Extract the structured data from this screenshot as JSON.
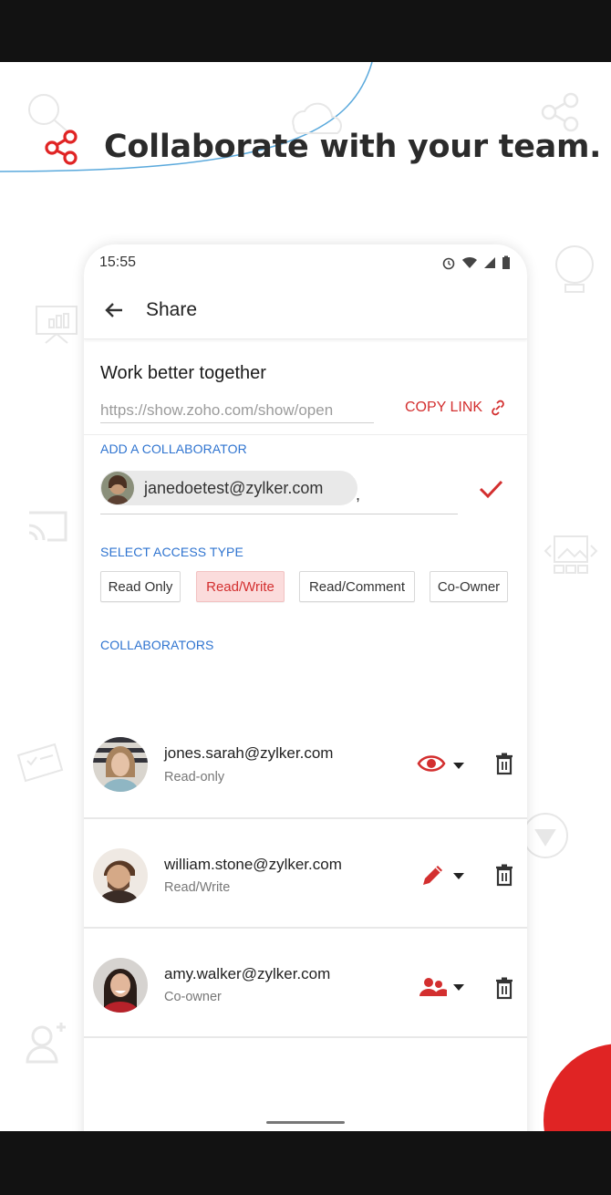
{
  "headline": {
    "text": "Collaborate with your team."
  },
  "status_bar": {
    "time": "15:55"
  },
  "app_bar": {
    "title": "Share"
  },
  "share": {
    "section_title": "Work better together",
    "link_value": "https://show.zoho.com/show/open",
    "copy_link_label": "COPY LINK"
  },
  "add_collaborator": {
    "label": "ADD A COLLABORATOR",
    "chip_email": "janedoetest@zylker.com",
    "separator": ","
  },
  "access": {
    "label": "SELECT ACCESS TYPE",
    "options": [
      "Read Only",
      "Read/Write",
      "Read/Comment",
      "Co-Owner"
    ],
    "selected": "Read/Write"
  },
  "collaborators": {
    "label": "COLLABORATORS",
    "items": [
      {
        "email": "jones.sarah@zylker.com",
        "role": "Read-only",
        "permission_icon": "eye-icon"
      },
      {
        "email": "william.stone@zylker.com",
        "role": "Read/Write",
        "permission_icon": "pencil-icon"
      },
      {
        "email": "amy.walker@zylker.com",
        "role": "Co-owner",
        "permission_icon": "co-owner-icon"
      }
    ]
  },
  "colors": {
    "accent": "#d32f2f",
    "link_blue": "#2f74d0",
    "selected_bg": "#fbdcdc"
  }
}
